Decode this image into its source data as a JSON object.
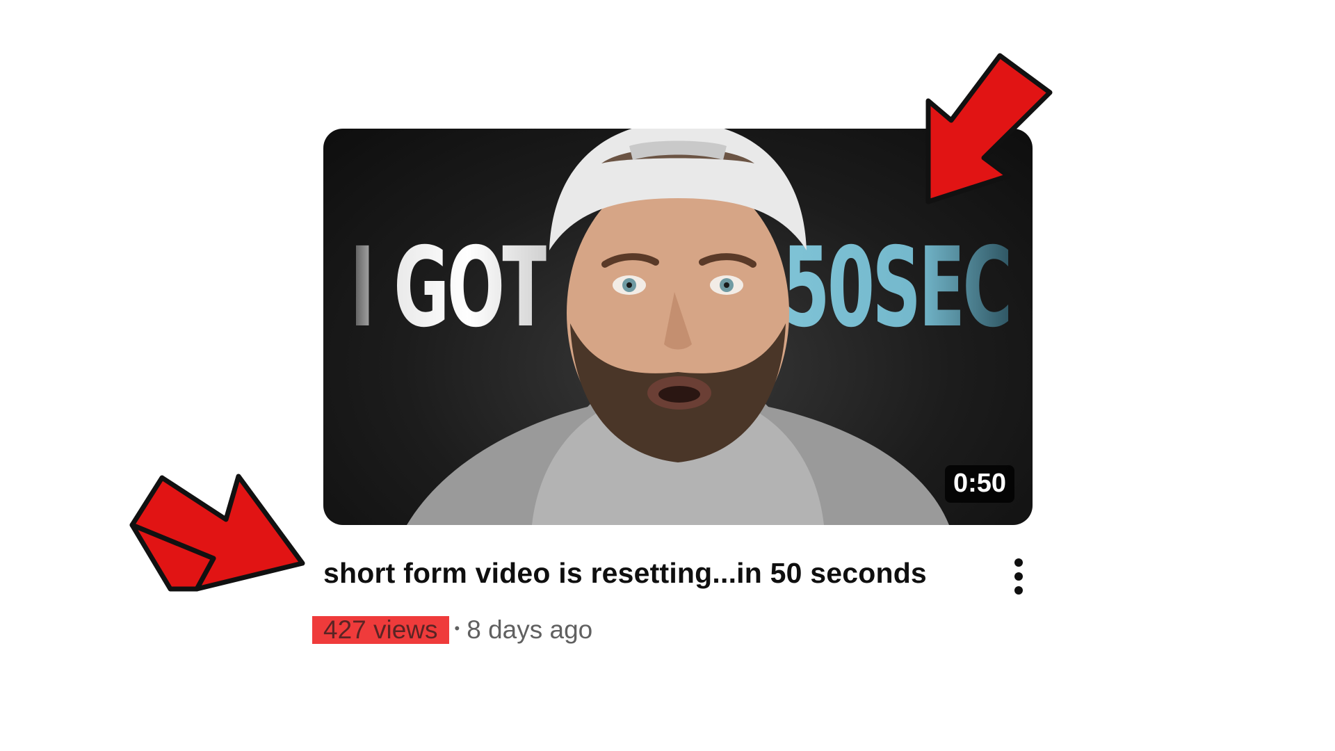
{
  "video": {
    "thumbnail_text_left": "I GOT",
    "thumbnail_text_right": "50SEC",
    "duration": "0:50",
    "title": "short form video is resetting...in 50 seconds",
    "views": "427 views",
    "separator": "•",
    "age": "8 days ago"
  },
  "icons": {
    "menu": "more-vert-icon",
    "annotation": "red-arrow-icon"
  },
  "colors": {
    "highlight": "#ef3b3b",
    "arrow": "#e11414",
    "title": "#0f0f0f",
    "meta": "#606060",
    "thumb_accent": "#7fc3d6"
  }
}
